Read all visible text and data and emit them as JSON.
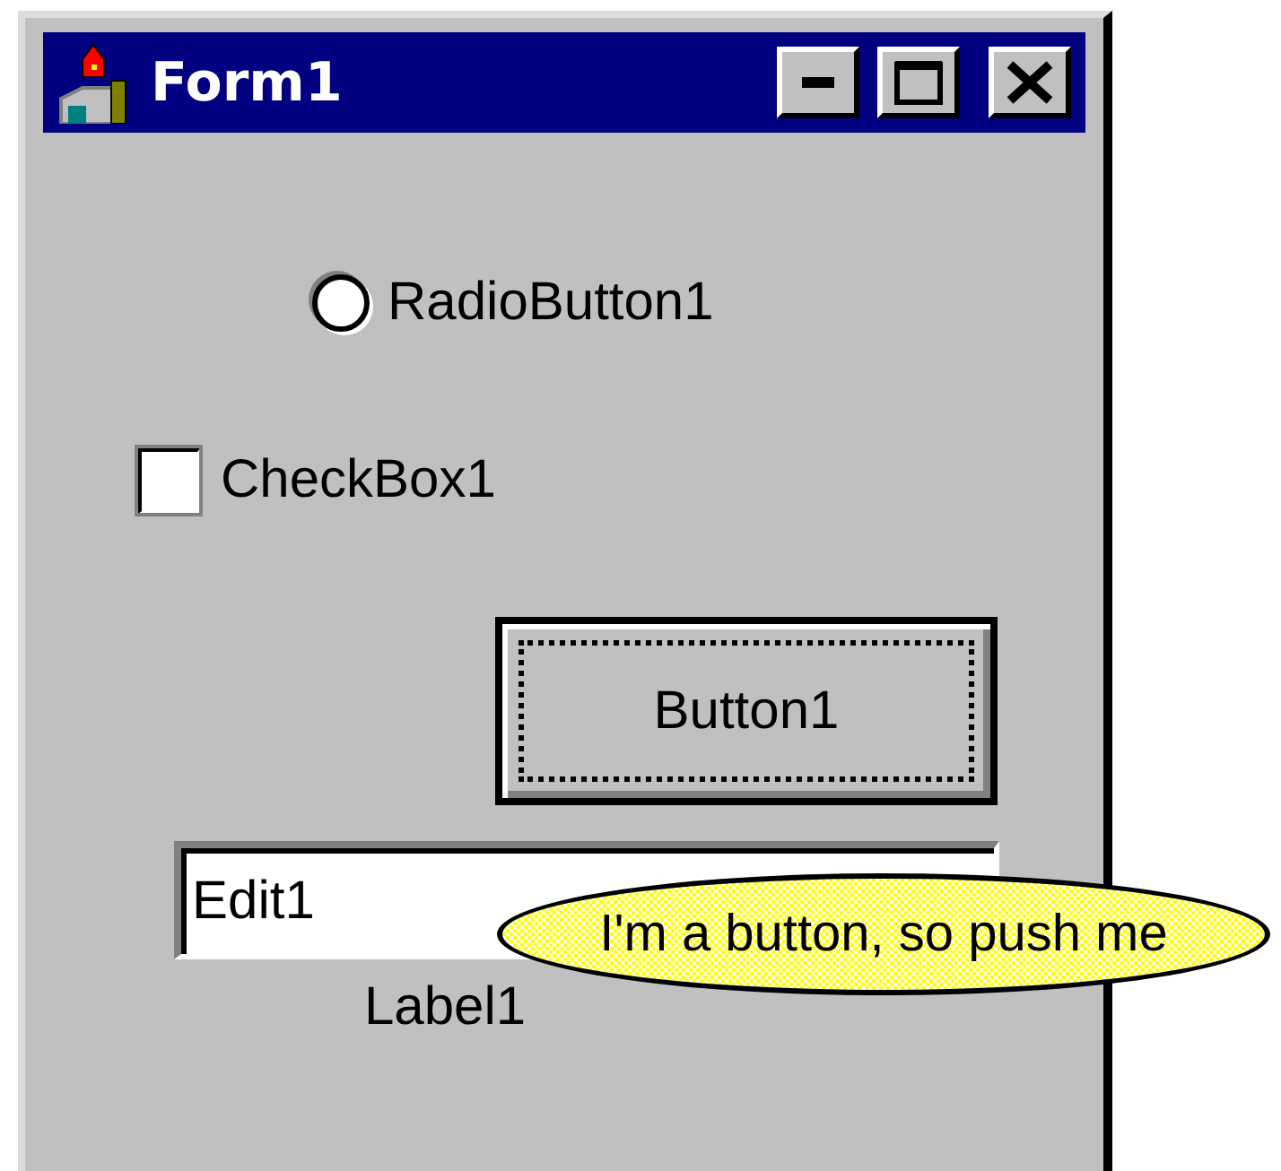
{
  "window": {
    "title": "Form1"
  },
  "radio": {
    "label": "RadioButton1",
    "selected": false
  },
  "checkbox": {
    "label": "CheckBox1",
    "checked": false
  },
  "button": {
    "label": "Button1",
    "focused": true
  },
  "edit": {
    "value": "Edit1"
  },
  "label": "Label1",
  "tooltip": {
    "text": "I'm a button, so push me"
  }
}
